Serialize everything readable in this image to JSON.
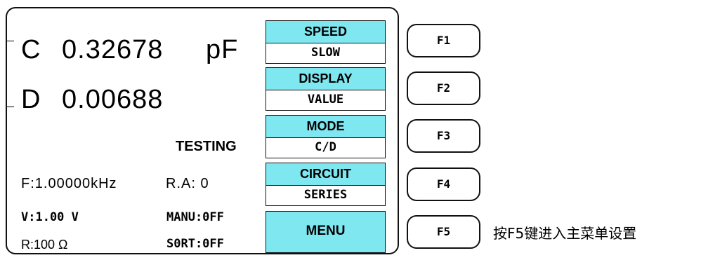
{
  "measure": {
    "primary_param": "C",
    "primary_value": "0.32678",
    "primary_unit": "pF",
    "secondary_param": "D",
    "secondary_value": "0.00688",
    "status": "TESTING"
  },
  "info": {
    "freq": "F:1.00000kHz",
    "range": "R.A: 0",
    "voltage": "V:1.00 V",
    "manual": "MANU:0FF",
    "resistance": "R:100 Ω",
    "sort": "S0RT:0FF"
  },
  "softkeys": [
    {
      "label": "SPEED",
      "value": "SLOW"
    },
    {
      "label": "DISPLAY",
      "value": "VALUE"
    },
    {
      "label": "MODE",
      "value": "C/D"
    },
    {
      "label": "CIRCUIT",
      "value": "SERIES"
    }
  ],
  "menu_label": "MENU",
  "fkeys": [
    "F1",
    "F2",
    "F3",
    "F4",
    "F5"
  ],
  "hint": "按F5键进入主菜单设置",
  "colors": {
    "softkey_bg": "#7fe7f0",
    "border": "#111111"
  }
}
